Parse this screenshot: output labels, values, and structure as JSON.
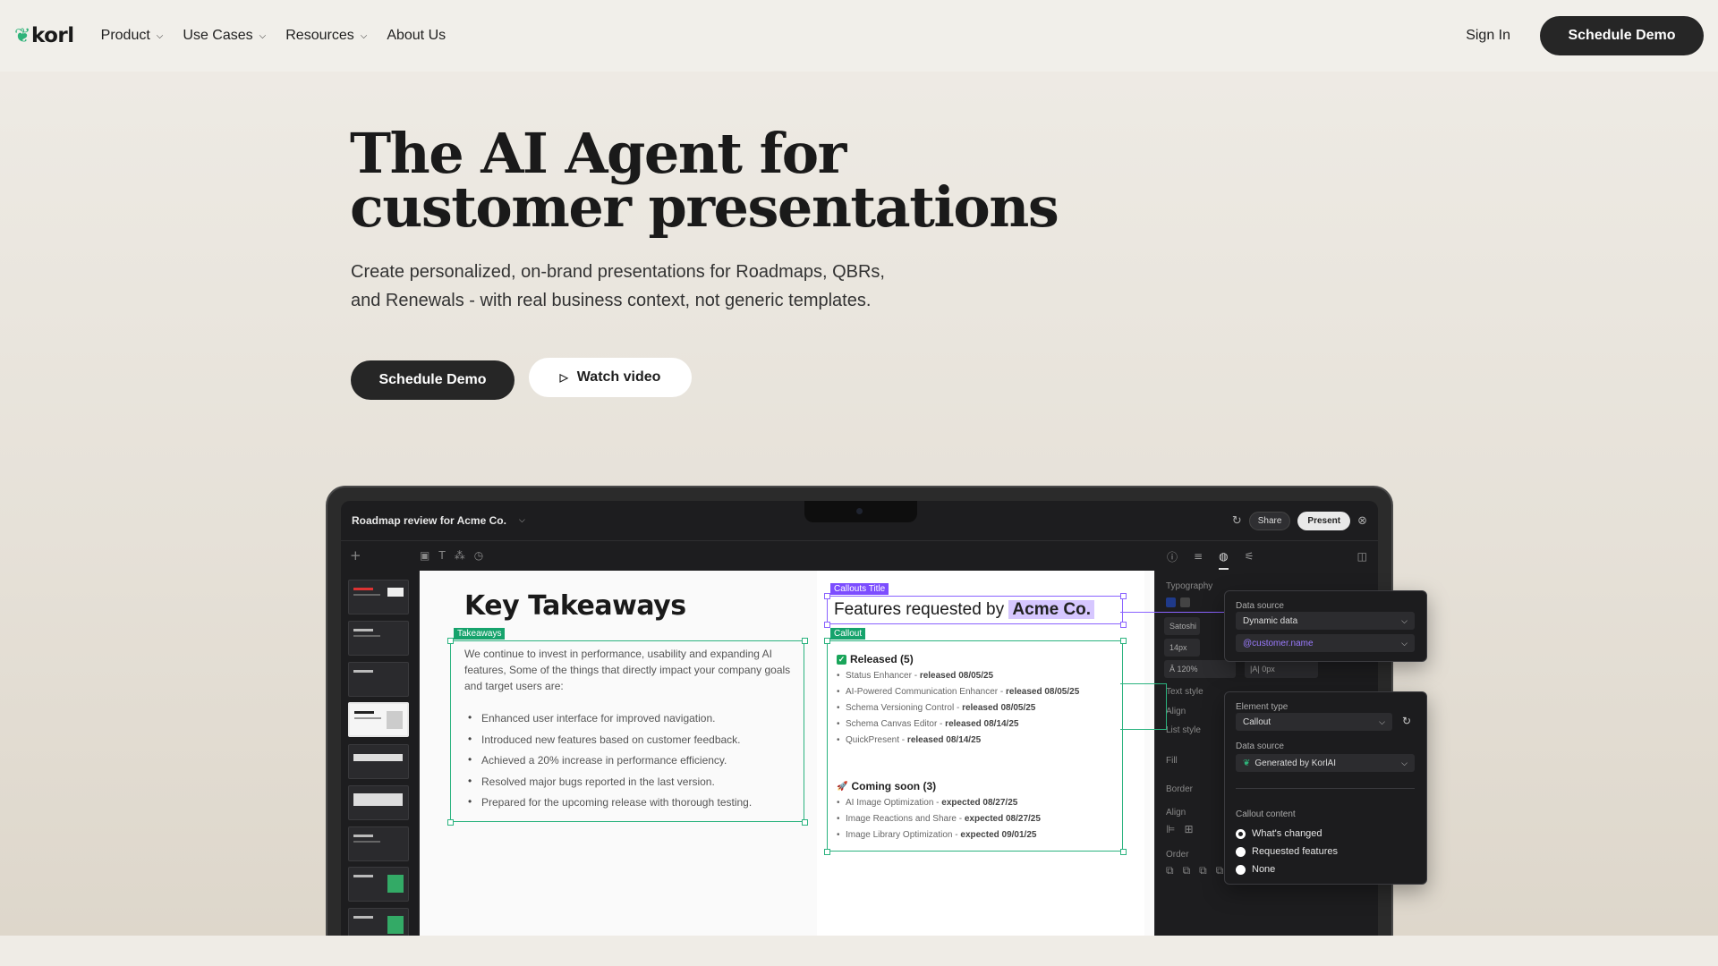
{
  "nav": {
    "logo": "korl",
    "items": [
      {
        "label": "Product",
        "has_dropdown": true
      },
      {
        "label": "Use Cases",
        "has_dropdown": true
      },
      {
        "label": "Resources",
        "has_dropdown": true
      },
      {
        "label": "About Us",
        "has_dropdown": false
      }
    ],
    "sign_in": "Sign In",
    "cta": "Schedule Demo"
  },
  "hero": {
    "title_line1": "The AI Agent for",
    "title_line2": "customer presentations",
    "subtitle_line1": "Create personalized, on-brand presentations for Roadmaps, QBRs,",
    "subtitle_line2": "and Renewals - with real business context, not generic templates.",
    "cta_primary": "Schedule Demo",
    "cta_secondary": "Watch video"
  },
  "app": {
    "doc_title": "Roadmap review for Acme Co.",
    "share": "Share",
    "present": "Present",
    "slide": {
      "heading": "Key Takeaways",
      "takeaways_tag": "Takeaways",
      "intro": "We continue to invest in performance, usability and expanding AI features, Some of the things that directly impact your company goals and target users are:",
      "bullets": [
        "Enhanced user interface for improved navigation.",
        "Introduced new features based on customer feedback.",
        "Achieved a 20% increase in performance efficiency.",
        "Resolved major bugs reported in the last version.",
        "Prepared for the upcoming release with thorough testing."
      ],
      "callouts_title_tag": "Callouts Title",
      "features_title": "Features requested by",
      "features_company": "Acme Co.",
      "callout_tag": "Callout",
      "released_heading": "Released (5)",
      "released": [
        {
          "name": "Status Enhancer",
          "status": "released 08/05/25"
        },
        {
          "name": "AI-Powered Communication Enhancer",
          "status": "released 08/05/25"
        },
        {
          "name": "Schema Versioning Control",
          "status": "released 08/05/25"
        },
        {
          "name": "Schema Canvas Editor",
          "status": "released 08/14/25"
        },
        {
          "name": "QuickPresent",
          "status": "released 08/14/25"
        }
      ],
      "coming_heading": "Coming soon (3)",
      "coming": [
        {
          "name": "AI Image Optimization",
          "status": "expected  08/27/25"
        },
        {
          "name": "Image Reactions and Share",
          "status": "expected  08/27/25"
        },
        {
          "name": "Image Library Optimization",
          "status": "expected  09/01/25"
        }
      ]
    },
    "panel": {
      "typography": "Typography",
      "font": "Satoshi",
      "size": "14px",
      "line_height": "120%",
      "letter_spacing": "0px",
      "text_style": "Text style",
      "align": "Align",
      "list_style": "List style",
      "fill": "Fill",
      "border": "Border",
      "align2": "Align",
      "order": "Order"
    },
    "popover1": {
      "label": "Data source",
      "value": "Dynamic data",
      "variable": "@customer.name"
    },
    "popover2": {
      "element_type_label": "Element type",
      "element_type": "Callout",
      "data_source_label": "Data source",
      "data_source": "Generated by KorlAI",
      "callout_content_label": "Callout content",
      "options": [
        {
          "label": "What's changed",
          "selected": true
        },
        {
          "label": "Requested features",
          "selected": false
        },
        {
          "label": "None",
          "selected": false
        }
      ]
    }
  },
  "colors": {
    "brand_dark": "#262626",
    "brand_green": "#2fb37a",
    "select_green": "#2bb37f",
    "select_purple": "#8a63ff",
    "highlight_purple": "#d6c7ff"
  }
}
